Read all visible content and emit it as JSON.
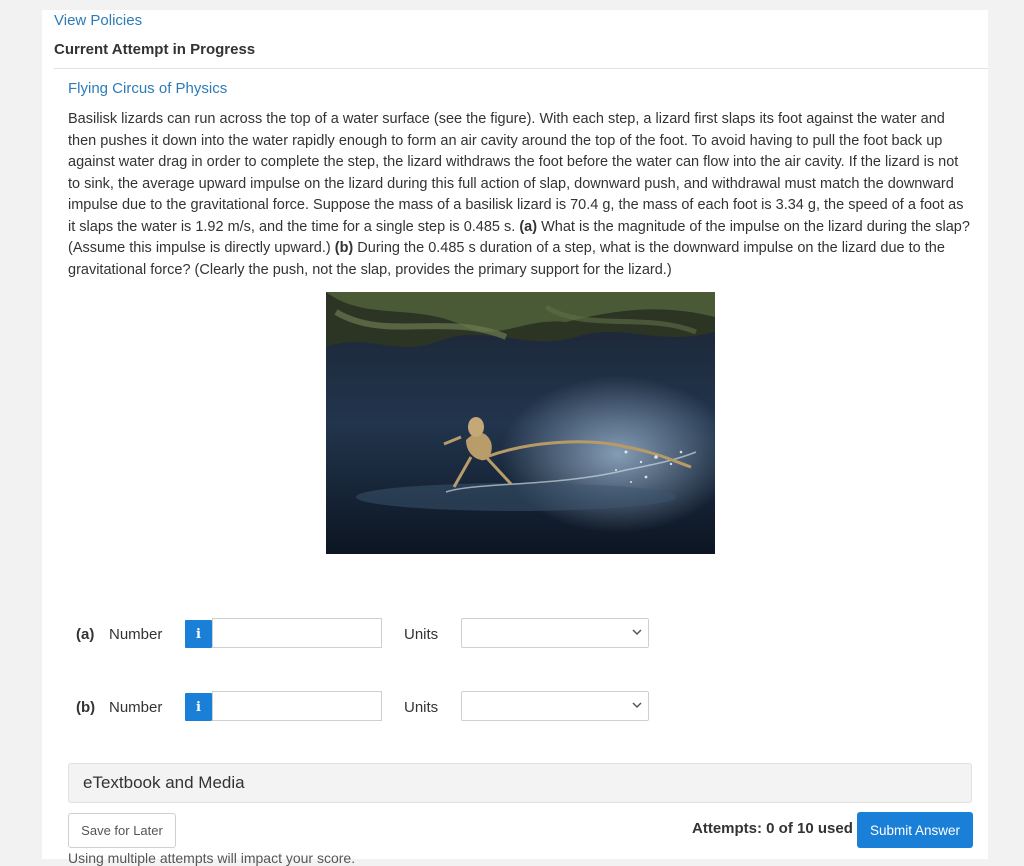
{
  "header": {
    "view_policies": "View Policies",
    "attempt_title": "Current Attempt in Progress"
  },
  "problem": {
    "source": "Flying Circus of Physics",
    "text_1": "Basilisk lizards can run across the top of a water surface (see the figure). With each step, a lizard first slaps its foot against the water and then pushes it down into the water rapidly enough to form an air cavity around the top of the foot. To avoid having to pull the foot back up against water drag in order to complete the step, the lizard withdraws the foot before the water can flow into the air cavity. If the lizard is not to sink, the average upward impulse on the lizard during this full action of slap, downward push, and withdrawal must match the downward impulse due to the gravitational force. Suppose the mass of a basilisk lizard is 70.4 g, the mass of each foot is 3.34 g, the speed of a foot as it slaps the water is 1.92 m/s, and the time for a single step is 0.485 s.",
    "part_a_marker": "(a)",
    "text_2": "What is the magnitude of the impulse on the lizard during the slap? (Assume this impulse is directly upward.)",
    "part_b_marker": "(b)",
    "text_3": "During the 0.485 s duration of a step, what is the downward impulse on the lizard due to the gravitational force? (Clearly the push, not the slap, provides the primary support for the lizard.)"
  },
  "questions": [
    {
      "part": "(a)",
      "label": "Number",
      "info": "i",
      "value": "",
      "units_label": "Units",
      "units_value": ""
    },
    {
      "part": "(b)",
      "label": "Number",
      "info": "i",
      "value": "",
      "units_label": "Units",
      "units_value": ""
    }
  ],
  "etextbook": "eTextbook and Media",
  "footer": {
    "save_label": "Save for Later",
    "attempts": "Attempts: 0 of 10 used",
    "submit_label": "Submit Answer",
    "note": "Using multiple attempts will impact your score."
  },
  "icons": {
    "info": "info-icon",
    "chevron": "chevron-down-icon"
  },
  "colors": {
    "link": "#2b7bb9",
    "accent": "#1a7fd6"
  }
}
